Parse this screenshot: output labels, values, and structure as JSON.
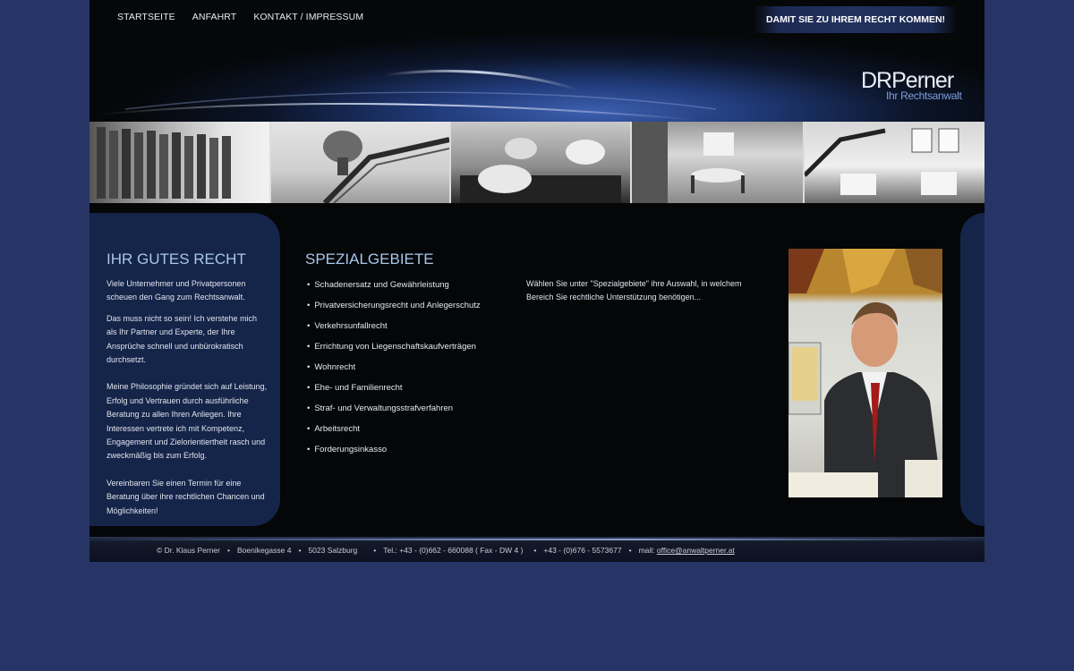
{
  "nav": {
    "items": [
      {
        "label": "STARTSEITE"
      },
      {
        "label": "ANFAHRT"
      },
      {
        "label": "KONTAKT / IMPRESSUM"
      }
    ]
  },
  "slogan": "DAMIT SIE ZU IHREM RECHT KOMMEN!",
  "logo": {
    "dr": "DR",
    "name": "Perner",
    "subtitle": "Ihr Rechtsanwalt"
  },
  "sidebar": {
    "title": "IHR GUTES RECHT",
    "paragraphs": [
      "Viele Unternehmer und Privatpersonen scheuen den Gang zum Rechtsanwalt.",
      "Das muss nicht so sein! Ich verstehe mich als Ihr Partner und Experte, der Ihre Ansprüche schnell und unbürokratisch durchsetzt.",
      "Meine Philosophie gründet sich auf Leistung, Erfolg und Vertrauen durch ausführliche Beratung zu allen Ihren Anliegen. Ihre Interessen vertrete ich mit Kompetenz, Engagement und Zielorientiertheit rasch und zweckmäßig bis zum Erfolg.",
      "Vereinbaren Sie einen Termin für eine Beratung über ihre rechtlichen Chancen und Möglichkeiten!"
    ]
  },
  "main": {
    "title": "SPEZIALGEBIETE",
    "bullet": "•",
    "items": [
      "Schadenersatz und Gewährleistung",
      "Privatversicherungsrecht und Anlegerschutz",
      "Verkehrsunfallrecht",
      "Errichtung von Liegenschaftskaufverträgen",
      "Wohnrecht",
      "Ehe- und Familienrecht",
      "Straf- und Verwaltungsstrafverfahren",
      "Arbeitsrecht",
      "Forderungsinkasso"
    ],
    "intro": "Wählen Sie unter \"Spezialgebiete\" ihre Auswahl, in welchem Bereich Sie rechtliche Unterstützung benötigen..."
  },
  "footer": {
    "copyright": "© Dr. Klaus Perner",
    "street": "Boenikegasse 4",
    "city": "5023 Salzburg",
    "phone": "Tel.: +43 - (0)662 - 660088 ( Fax - DW 4 )",
    "mobile": "+43 - (0)676 - 5573677",
    "mail_label": "mail:",
    "email": "office@anwaltperner.at",
    "separator": "•"
  },
  "colors": {
    "background": "#263566",
    "panel": "#152449",
    "heading": "#a9c6ea"
  }
}
